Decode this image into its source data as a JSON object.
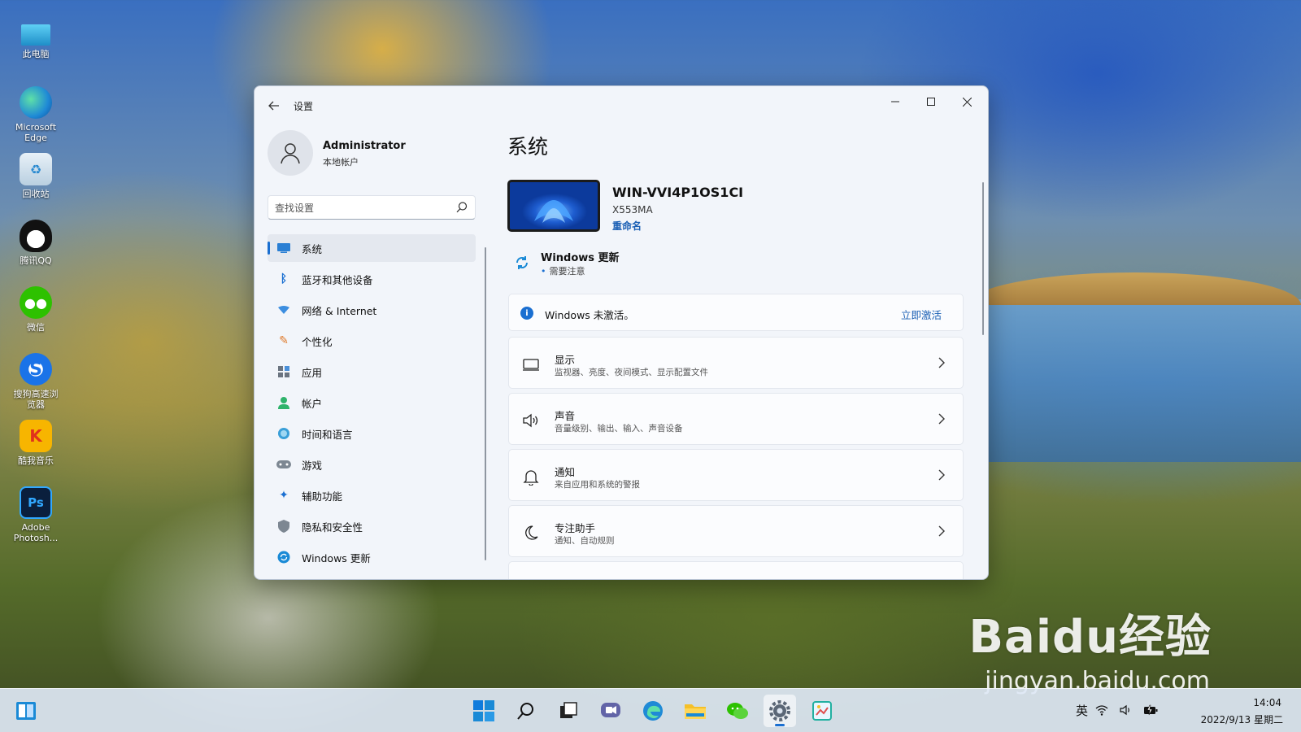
{
  "desktop": {
    "icons": [
      {
        "label": "此电脑",
        "icon": "computer-icon",
        "color": "#2aa7d8"
      },
      {
        "label": "Microsoft Edge",
        "icon": "edge-icon",
        "color": "#1f8ad6"
      },
      {
        "label": "回收站",
        "icon": "recycle-bin-icon",
        "color": "#c9dbe8"
      },
      {
        "label": "腾讯QQ",
        "icon": "qq-icon",
        "color": "#111111"
      },
      {
        "label": "微信",
        "icon": "wechat-icon",
        "color": "#2dc100"
      },
      {
        "label": "搜狗高速浏览器",
        "icon": "sogou-browser-icon",
        "color": "#1a73e8"
      },
      {
        "label": "酷我音乐",
        "icon": "kuwo-music-icon",
        "color": "#f7b500"
      },
      {
        "label": "Adobe Photosh...",
        "icon": "photoshop-icon",
        "color": "#0a1f3d"
      }
    ],
    "watermark": "Bai\u0000du 经验",
    "watermark_text": "Baidu经验",
    "watermark_url": "jingyan.baidu.com"
  },
  "window": {
    "title": "设置",
    "back_icon": "back-arrow-icon"
  },
  "profile": {
    "name": "Administrator",
    "account_type": "本地帐户"
  },
  "search": {
    "placeholder": "查找设置"
  },
  "nav": {
    "items": [
      {
        "label": "系统",
        "icon": "system-icon",
        "active": true
      },
      {
        "label": "蓝牙和其他设备",
        "icon": "bluetooth-icon"
      },
      {
        "label": "网络 & Internet",
        "icon": "network-icon"
      },
      {
        "label": "个性化",
        "icon": "personalization-icon"
      },
      {
        "label": "应用",
        "icon": "apps-icon"
      },
      {
        "label": "帐户",
        "icon": "accounts-icon"
      },
      {
        "label": "时间和语言",
        "icon": "time-language-icon"
      },
      {
        "label": "游戏",
        "icon": "gaming-icon"
      },
      {
        "label": "辅助功能",
        "icon": "accessibility-icon"
      },
      {
        "label": "隐私和安全性",
        "icon": "privacy-icon"
      },
      {
        "label": "Windows 更新",
        "icon": "windows-update-icon"
      }
    ]
  },
  "main": {
    "title": "系统",
    "device": {
      "name": "WIN-VVI4P1OS1CI",
      "model": "X553MA",
      "rename": "重命名"
    },
    "update": {
      "title": "Windows 更新",
      "status": "需要注意"
    },
    "activation": {
      "text": "Windows 未激活。",
      "action": "立即激活"
    },
    "rows": [
      {
        "title": "显示",
        "subtitle": "监视器、亮度、夜间模式、显示配置文件",
        "icon": "display-icon"
      },
      {
        "title": "声音",
        "subtitle": "音量级别、输出、输入、声音设备",
        "icon": "sound-icon"
      },
      {
        "title": "通知",
        "subtitle": "来自应用和系统的警报",
        "icon": "notification-icon"
      },
      {
        "title": "专注助手",
        "subtitle": "通知、自动规则",
        "icon": "focus-assist-icon"
      }
    ]
  },
  "taskbar": {
    "ime": "英",
    "time": "14:04",
    "date": "2022/9/13 星期二"
  },
  "colors": {
    "accent": "#1a6fd1",
    "link": "#1a5fb4"
  }
}
